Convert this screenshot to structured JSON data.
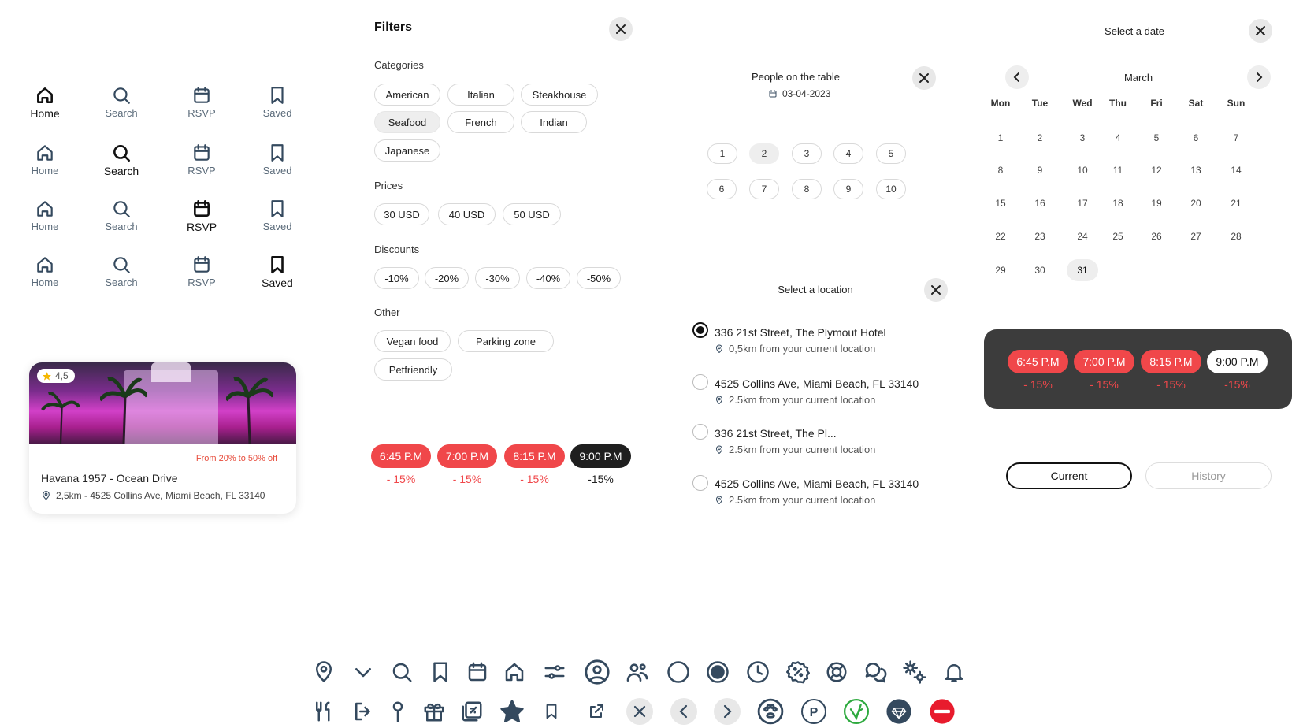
{
  "nav": {
    "home": "Home",
    "search": "Search",
    "rsvp": "RSVP",
    "saved": "Saved"
  },
  "card": {
    "rating": "4,5",
    "promo": "From 20% to 50% off",
    "name": "Havana 1957 - Ocean Drive",
    "address": "2,5km - 4525 Collins Ave, Miami Beach, FL 33140"
  },
  "filters": {
    "title": "Filters",
    "categories_label": "Categories",
    "categories": [
      "American",
      "Italian",
      "Steakhouse",
      "Seafood",
      "French",
      "Indian",
      "Japanese"
    ],
    "selected_category": "Seafood",
    "prices_label": "Prices",
    "prices": [
      "30 USD",
      "40 USD",
      "50 USD"
    ],
    "discounts_label": "Discounts",
    "discounts": [
      "-10%",
      "-20%",
      "-30%",
      "-40%",
      "-50%"
    ],
    "other_label": "Other",
    "other": [
      "Vegan food",
      "Parking zone",
      "Petfriendly"
    ]
  },
  "times_left": [
    {
      "time": "6:45 P.M",
      "disc": "- 15%"
    },
    {
      "time": "7:00 P.M",
      "disc": "- 15%"
    },
    {
      "time": "8:15 P.M",
      "disc": "- 15%"
    },
    {
      "time": "9:00 P.M",
      "disc": "-15%"
    }
  ],
  "people": {
    "title": "People on the table",
    "date": "03-04-2023",
    "numbers": [
      "1",
      "2",
      "3",
      "4",
      "5",
      "6",
      "7",
      "8",
      "9",
      "10"
    ],
    "selected": "2"
  },
  "location": {
    "title": "Select a location",
    "items": [
      {
        "name": "336 21st Street, The Plymout Hotel",
        "dist": "0,5km from your current location",
        "selected": true
      },
      {
        "name": "4525 Collins Ave, Miami Beach, FL 33140",
        "dist": "2.5km from your current location",
        "selected": false
      },
      {
        "name": "336 21st Street, The Pl...",
        "dist": "2.5km from your current location",
        "selected": false
      },
      {
        "name": "4525 Collins Ave, Miami Beach, FL 33140",
        "dist": "2.5km from your current location",
        "selected": false
      }
    ]
  },
  "calendar": {
    "title": "Select a date",
    "month": "March",
    "weekdays": [
      "Mon",
      "Tue",
      "Wed",
      "Thu",
      "Fri",
      "Sat",
      "Sun"
    ],
    "days": [
      "1",
      "2",
      "3",
      "4",
      "5",
      "6",
      "7",
      "8",
      "9",
      "10",
      "11",
      "12",
      "13",
      "14",
      "15",
      "16",
      "17",
      "18",
      "19",
      "20",
      "21",
      "22",
      "23",
      "24",
      "25",
      "26",
      "27",
      "28",
      "29",
      "30",
      "31"
    ],
    "selected": "31"
  },
  "times_right": [
    {
      "time": "6:45 P.M",
      "disc": "- 15%"
    },
    {
      "time": "7:00 P.M",
      "disc": "- 15%"
    },
    {
      "time": "8:15 P.M",
      "disc": "- 15%"
    },
    {
      "time": "9:00 P.M",
      "disc": "-15%"
    }
  ],
  "tabs": {
    "current": "Current",
    "history": "History"
  },
  "colors": {
    "accent_red": "#f0474a",
    "dark": "#1f1f1f",
    "panel": "#3c3c3c",
    "icon": "#34495e"
  },
  "icon_row_1": [
    "location-pin-icon",
    "chevron-down-icon",
    "search-icon",
    "bookmark-icon",
    "calendar-icon",
    "home-icon",
    "sliders-icon",
    "user-circle-icon",
    "users-icon",
    "circle-icon",
    "radio-icon",
    "clock-icon",
    "discount-icon",
    "lifebuoy-icon",
    "chat-icon",
    "settings-icon",
    "bell-icon"
  ],
  "icon_row_2": [
    "utensils-icon",
    "logout-icon",
    "pin-icon",
    "gift-icon",
    "link-icon",
    "star-icon",
    "bookmark-small-icon",
    "share-icon",
    "close-circle-icon",
    "chevron-left-circle-icon",
    "chevron-right-circle-icon",
    "paw-icon",
    "parking-icon",
    "vegan-icon",
    "diamond-icon",
    "no-entry-icon"
  ],
  "icon_letters": {
    "parking": "P"
  }
}
